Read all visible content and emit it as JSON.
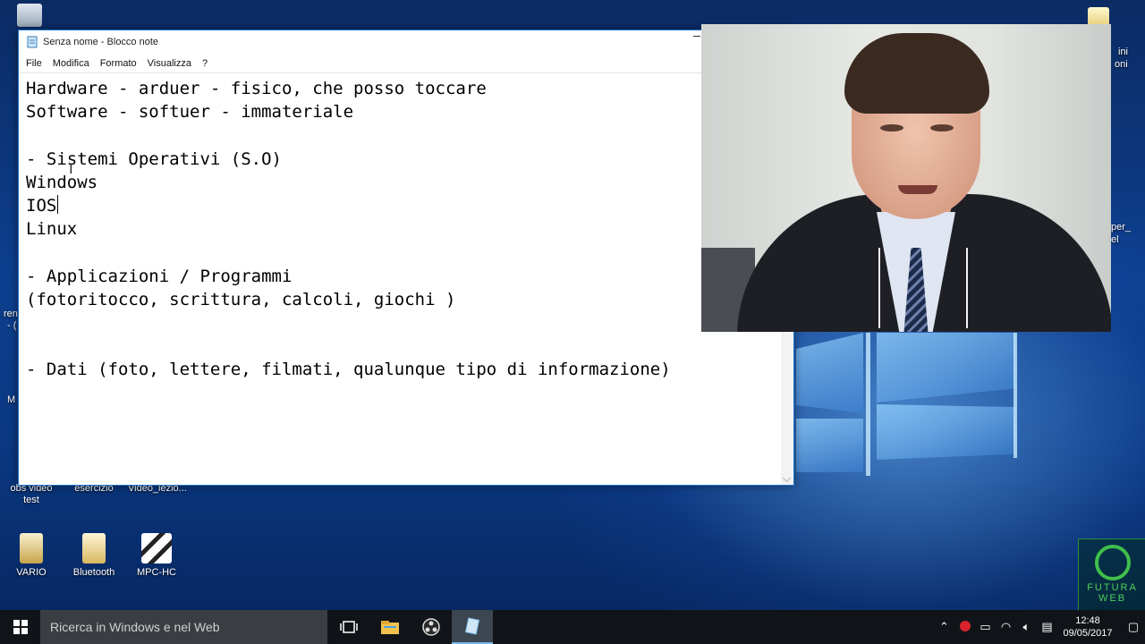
{
  "notepad": {
    "title": "Senza nome - Blocco note",
    "menu": [
      "File",
      "Modifica",
      "Formato",
      "Visualizza",
      "?"
    ],
    "lines": [
      "Hardware - arduer - fisico, che posso toccare",
      "Software - softuer - immateriale",
      "",
      "- Sistemi Operativi (S.O)",
      "Windows",
      "IOS",
      "Linux",
      "",
      "- Applicazioni / Programmi",
      "(fotoritocco, scrittura, calcoli, giochi )",
      "",
      "",
      "- Dati (foto, lettere, filmati, qualunque tipo di informazione)"
    ]
  },
  "desktop": {
    "icons": [
      {
        "label": "obs video test",
        "icon": "obs-icon"
      },
      {
        "label": "esercizio",
        "icon": "file-icon"
      },
      {
        "label": "Video_lezio...",
        "icon": "video-file-icon"
      },
      {
        "label": "VARIO",
        "icon": "folder-icon"
      },
      {
        "label": "Bluetooth",
        "icon": "bluetooth-icon"
      },
      {
        "label": "MPC-HC",
        "icon": "mpc-hc-icon"
      }
    ],
    "partial_labels": [
      "ini",
      "oni",
      "per_",
      "el",
      "ren",
      "- (",
      "M"
    ]
  },
  "logo": {
    "text": "FUTURA WEB"
  },
  "taskbar": {
    "search_placeholder": "Ricerca in Windows e nel Web",
    "time": "12:48",
    "date": "09/05/2017"
  }
}
